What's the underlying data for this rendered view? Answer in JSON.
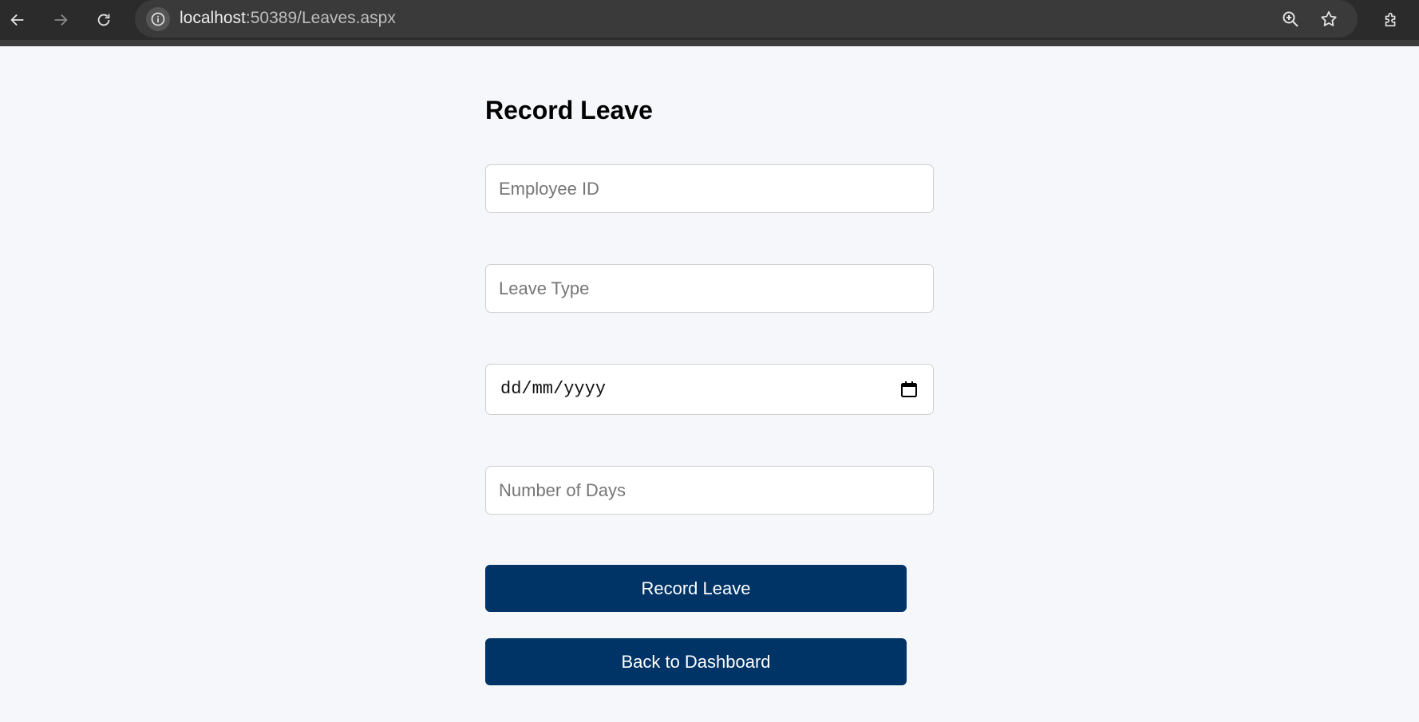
{
  "browser": {
    "url_host": "localhost",
    "url_path": ":50389/Leaves.aspx"
  },
  "page": {
    "heading": "Record Leave"
  },
  "form": {
    "employee_id_placeholder": "Employee ID",
    "leave_type_placeholder": "Leave Type",
    "date_placeholder": "dd/mm/yyyy",
    "days_placeholder": "Number of Days",
    "submit_label": "Record Leave",
    "back_label": "Back to Dashboard"
  },
  "colors": {
    "accent": "#003366",
    "page_background": "#f5f7fa",
    "toolbar": "#2b2b2b"
  },
  "icons": {
    "back": "arrow-left-icon",
    "forward": "arrow-right-icon",
    "reload": "reload-icon",
    "site_info": "info-icon",
    "zoom": "zoom-in-icon",
    "bookmark": "star-icon",
    "extensions": "puzzle-icon",
    "calendar": "calendar-icon"
  }
}
